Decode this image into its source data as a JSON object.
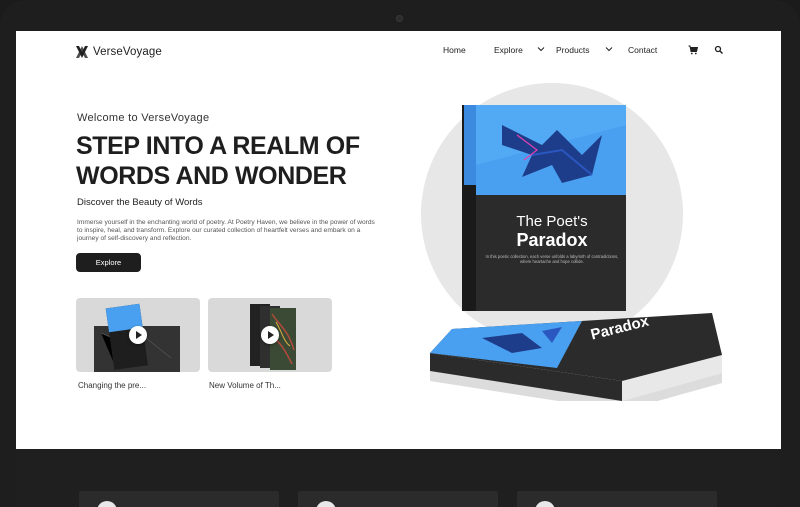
{
  "brand": {
    "name": "VerseVoyage"
  },
  "nav": {
    "home": "Home",
    "explore": "Explore",
    "products": "Products",
    "contact": "Contact",
    "icons": [
      "cart-icon",
      "search-icon"
    ]
  },
  "hero": {
    "welcome": "Welcome to VerseVoyage",
    "headline_line1": "STEP INTO A REALM OF",
    "headline_line2": "WORDS AND WONDER",
    "subhead": "Discover the Beauty of Words",
    "body": "Immerse yourself in the enchanting world of poetry. At Poetry Haven, we believe in the power of words to inspire, heal, and transform. Explore our curated collection of heartfelt verses and embark on a journey of self-discovery and reflection.",
    "cta": "Explore"
  },
  "videos": [
    {
      "caption": "Changing the pre..."
    },
    {
      "caption": "New Volume of Th..."
    }
  ],
  "book": {
    "title_line1": "The Poet's",
    "title_line2": "Paradox",
    "blurb": "In this poetic collection, each verse unfolds a labyrinth of contradictions, where heartache and hope collide.",
    "flat_title": "Paradox"
  },
  "colors": {
    "accent_dark": "#1e1e1e",
    "book_cover_blue": "#4aa0f0",
    "book_dark": "#2c2c2c"
  }
}
